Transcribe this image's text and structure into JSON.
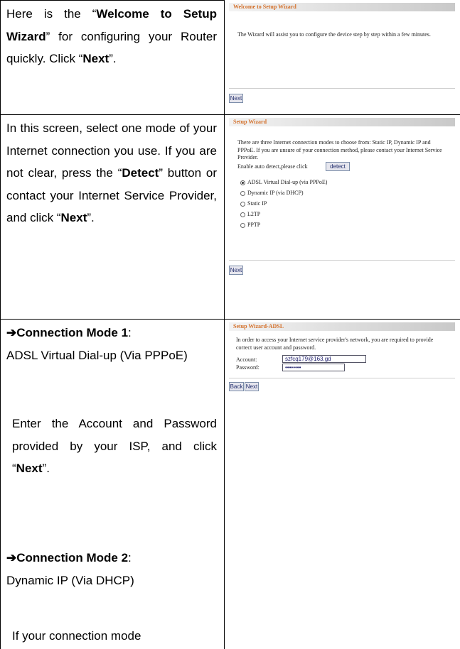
{
  "rows": [
    {
      "pre": "Here is the “",
      "bold1": "Welcome to Setup Wizard",
      "mid": "” for configuring your Router quickly. Click “",
      "bold2": "Next",
      "post": "”."
    },
    {
      "pre": "In this screen, select one mode of your Internet connection you use. If you are not clear, press the “",
      "bold1": "Detect",
      "mid": "” button or contact your Internet Service Provider, and click “",
      "bold2": "Next",
      "post": "”."
    },
    {
      "mode1_arrow": "➔",
      "mode1_title": "Connection Mode 1",
      "mode1_colon": ":",
      "mode1_desc": "ADSL Virtual Dial-up (Via PPPoE)",
      "mode1_body_pre": "Enter the Account and Password provided by your ISP, and click “",
      "mode1_body_bold": "Next",
      "mode1_body_post": "”.",
      "mode2_arrow": "➔",
      "mode2_title": "Connection Mode 2",
      "mode2_colon": ":",
      "mode2_desc": "Dynamic IP (Via DHCP)",
      "mode2_body": "If your connection mode"
    }
  ],
  "screenshots": {
    "welcome": {
      "title": "Welcome to Setup Wizard",
      "text": "The Wizard will assist you to configure the device step by step within a few minutes.",
      "next_label": "Next"
    },
    "wizard": {
      "title": "Setup Wizard",
      "text": "There are three Internet connection modes to choose from: Static IP, Dynamic IP and PPPoE. If you are unsure of your connection method, please contact your Internet Service Provider.",
      "detect_prompt": "Enable auto detect,please click",
      "detect_label": "detect",
      "options": [
        {
          "label": "ADSL Virtual Dial-up (via PPPoE)",
          "selected": true
        },
        {
          "label": "Dynamic IP (via DHCP)",
          "selected": false
        },
        {
          "label": "Static IP",
          "selected": false
        },
        {
          "label": "L2TP",
          "selected": false
        },
        {
          "label": "PPTP",
          "selected": false
        }
      ],
      "next_label": "Next"
    },
    "adsl": {
      "title": "Setup Wizard-ADSL",
      "text": "In order to access your Internet service provider's network, you are required to provide correct user account and password.",
      "account_label": "Account:",
      "account_value": "szfcq179@163.gd",
      "password_label": "Password:",
      "password_value": "••••••••",
      "back_label": "Back",
      "next_label": "Next"
    }
  }
}
